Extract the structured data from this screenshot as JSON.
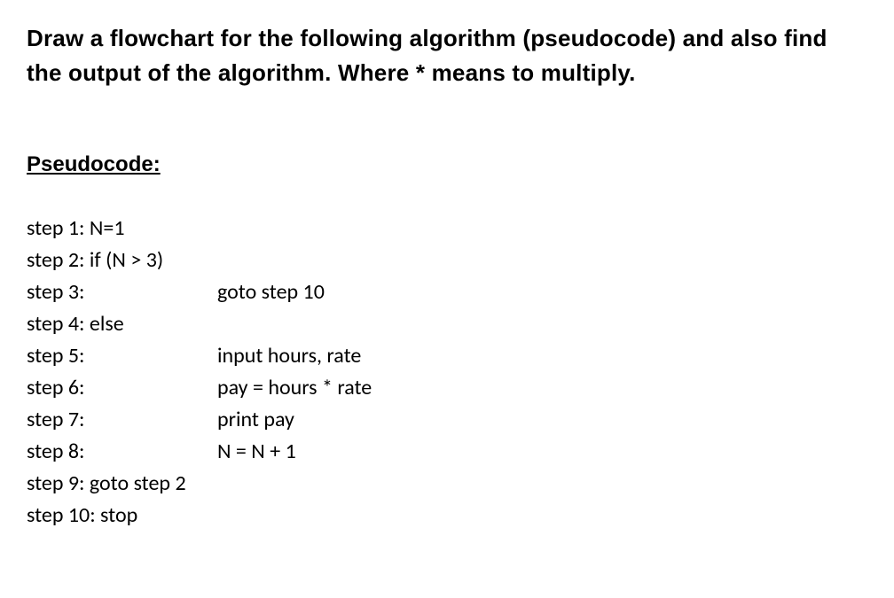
{
  "title": "Draw a flowchart for the following algorithm (pseudocode) and also find the output of the algorithm. Where * means to multiply.",
  "section_heading": "Pseudocode:",
  "steps": [
    {
      "label": "step 1: N=1",
      "body": ""
    },
    {
      "label": "step 2: if (N > 3)",
      "body": ""
    },
    {
      "label": "step 3:",
      "body": "goto step 10"
    },
    {
      "label": "step 4: else",
      "body": ""
    },
    {
      "label": "step 5:",
      "body": "input hours, rate"
    },
    {
      "label": "step 6:",
      "body": "pay = hours * rate"
    },
    {
      "label": "step 7:",
      "body": "print pay"
    },
    {
      "label": "step 8:",
      "body": "N = N + 1"
    },
    {
      "label": "step 9: goto step 2",
      "body": ""
    },
    {
      "label": "step 10: stop",
      "body": ""
    }
  ]
}
